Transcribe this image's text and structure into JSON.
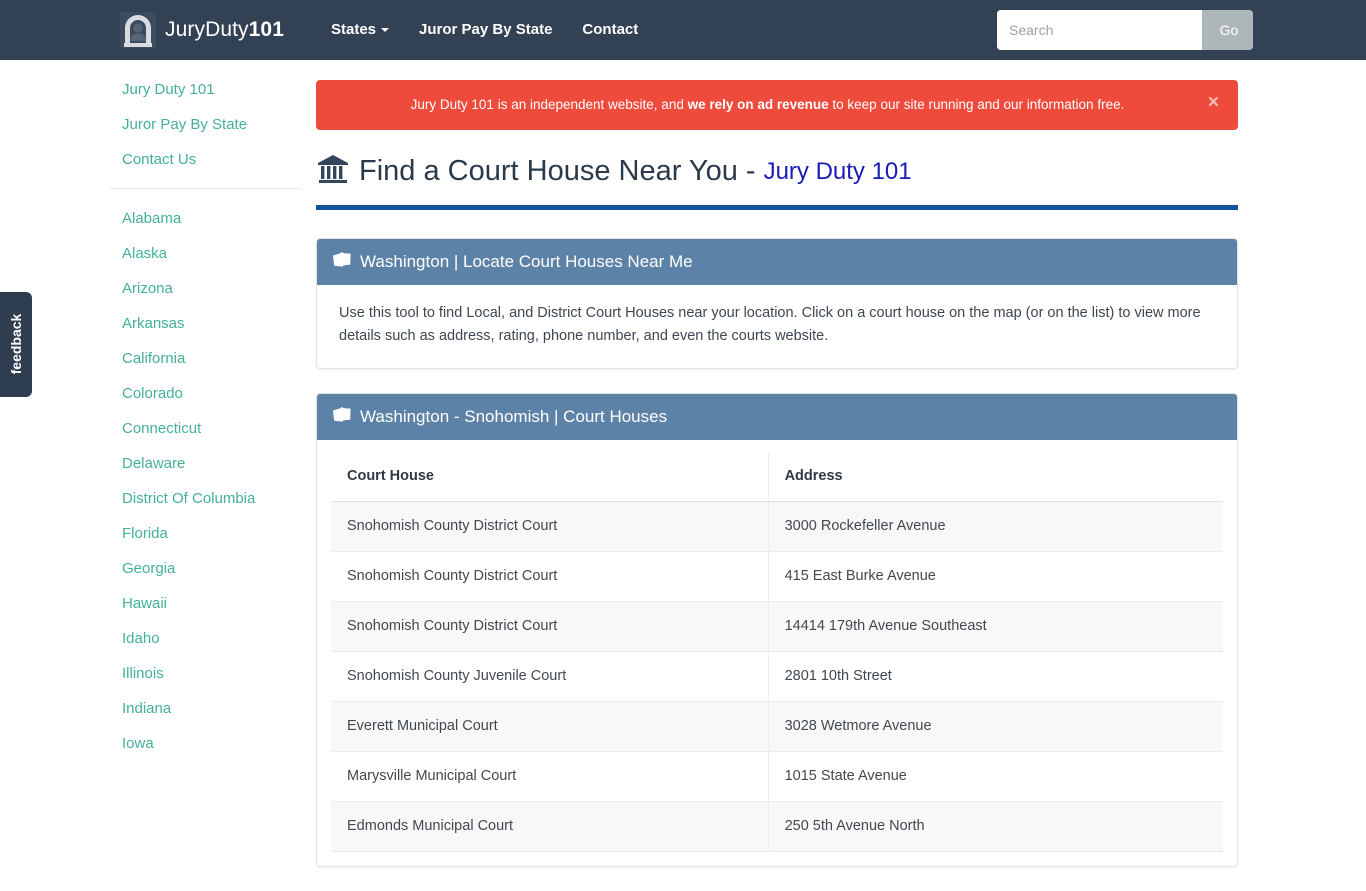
{
  "navbar": {
    "brand": {
      "text_light": "JuryDuty",
      "text_bold": "101",
      "logo_icon": "courthouse-logo-icon"
    },
    "links": [
      {
        "label": "States",
        "has_caret": true
      },
      {
        "label": "Juror Pay By State",
        "has_caret": false
      },
      {
        "label": "Contact",
        "has_caret": false
      }
    ],
    "search": {
      "placeholder": "Search",
      "value": "",
      "button_label": "Go"
    }
  },
  "feedback": {
    "label": "feedback"
  },
  "sidebar": {
    "top_links": [
      {
        "label": "Jury Duty 101"
      },
      {
        "label": "Juror Pay By State"
      },
      {
        "label": "Contact Us"
      }
    ],
    "states": [
      {
        "label": "Alabama"
      },
      {
        "label": "Alaska"
      },
      {
        "label": "Arizona"
      },
      {
        "label": "Arkansas"
      },
      {
        "label": "California"
      },
      {
        "label": "Colorado"
      },
      {
        "label": "Connecticut"
      },
      {
        "label": "Delaware"
      },
      {
        "label": "District Of Columbia"
      },
      {
        "label": "Florida"
      },
      {
        "label": "Georgia"
      },
      {
        "label": "Hawaii"
      },
      {
        "label": "Idaho"
      },
      {
        "label": "Illinois"
      },
      {
        "label": "Indiana"
      },
      {
        "label": "Iowa"
      }
    ]
  },
  "alert": {
    "text_before": "Jury Duty 101 is an independent website, and ",
    "text_bold": "we rely on ad revenue",
    "text_after": " to keep our site running and our information free.",
    "close_label": "×",
    "background_color": "#ee4b3c"
  },
  "page": {
    "title": "Find a Court House Near You -",
    "title_link": "Jury Duty 101",
    "title_icon": "classical-building-icon",
    "underline_color": "#11549c"
  },
  "panels": [
    {
      "icon": "washington-state-icon",
      "heading": "Washington | Locate Court Houses Near Me",
      "body": "Use this tool to find Local, and District Court Houses near your location. Click on a court house on the map (or on the list) to view more details such as address, rating, phone number, and even the courts website."
    },
    {
      "icon": "washington-state-icon",
      "heading": "Washington - Snohomish | Court Houses"
    }
  ],
  "courts_table": {
    "columns": [
      "Court House",
      "Address"
    ],
    "rows": [
      [
        "Snohomish County District Court",
        "3000 Rockefeller Avenue"
      ],
      [
        "Snohomish County District Court",
        "415 East Burke Avenue"
      ],
      [
        "Snohomish County District Court",
        "14414 179th Avenue Southeast"
      ],
      [
        "Snohomish County Juvenile Court",
        "2801 10th Street"
      ],
      [
        "Everett Municipal Court",
        "3028 Wetmore Avenue"
      ],
      [
        "Marysville Municipal Court",
        "1015 State Avenue"
      ],
      [
        "Edmonds Municipal Court",
        "250 5th Avenue North"
      ]
    ]
  },
  "colors": {
    "navbar": "#324154",
    "panel_header": "#5d82a7",
    "sidebar_link": "#44b09b",
    "title_link": "#1a1ab8"
  }
}
